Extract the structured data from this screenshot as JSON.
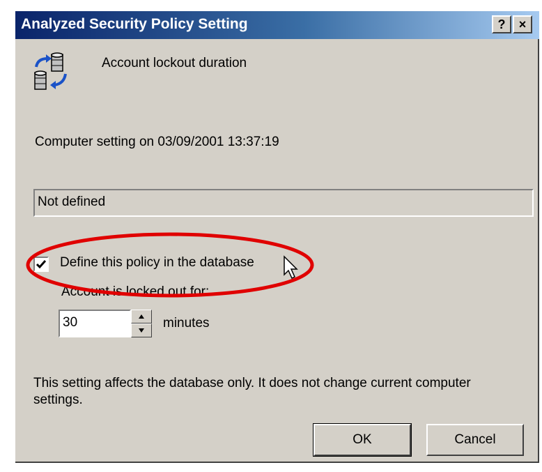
{
  "window": {
    "title": "Analyzed Security Policy Setting",
    "help_label": "?",
    "close_label": "×"
  },
  "policy": {
    "name": "Account lockout duration",
    "icon": "policy-database-icon"
  },
  "computer_setting": {
    "label": "Computer setting on 03/09/2001 13:37:19",
    "value": "Not defined"
  },
  "define_policy": {
    "checked": true,
    "label": "Define this policy in the database"
  },
  "lockout": {
    "label": "Account is locked out for:",
    "value": "30",
    "unit": "minutes"
  },
  "note": "This setting affects the database only. It does not change current computer settings.",
  "buttons": {
    "ok": "OK",
    "cancel": "Cancel"
  },
  "annotation": {
    "highlight_color": "#e00000"
  }
}
